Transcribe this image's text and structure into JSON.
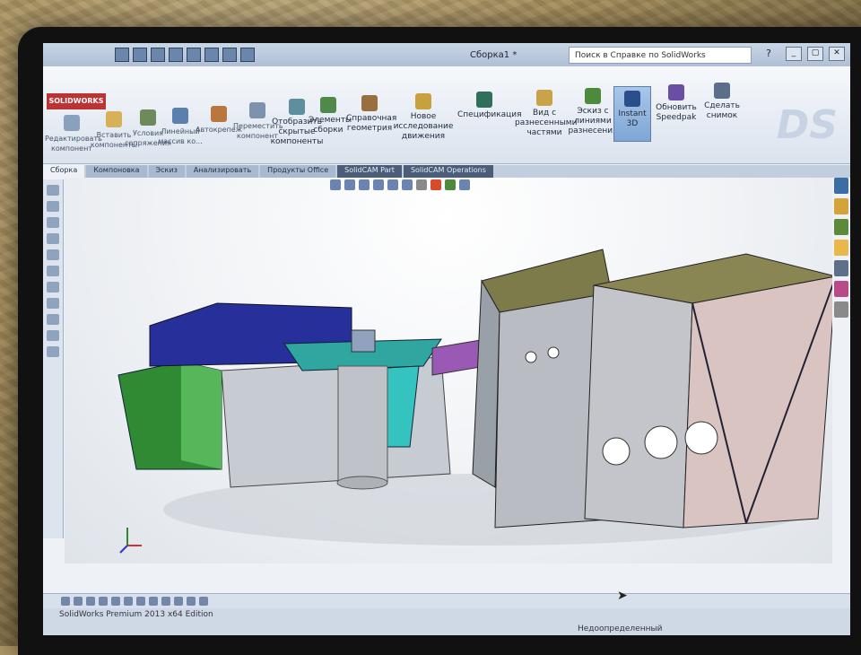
{
  "app": {
    "logo_text": "SOLIDWORKS",
    "document_title": "Сборка1 *",
    "help_search_placeholder": "Поиск в Справке по SolidWorks"
  },
  "ribbon": {
    "small_buttons": [
      {
        "label": "Редактировать компонент"
      },
      {
        "label": "Вставить компоненты"
      },
      {
        "label": "Условия сопряжения"
      },
      {
        "label": "Линейный массив ко..."
      },
      {
        "label": "Автокрепеж"
      },
      {
        "label": "Переместить компонент"
      },
      {
        "label": "Отобразить скрытые компоненты"
      },
      {
        "label": "Элементы сборки"
      },
      {
        "label": "Справочная геометрия"
      },
      {
        "label": "Новое исследование движения"
      },
      {
        "label": "Спецификация"
      },
      {
        "label": "Вид с разнесенными частями"
      },
      {
        "label": "Эскиз с линиями разнесения"
      },
      {
        "label": "Instant 3D"
      },
      {
        "label": "Обновить Speedpak"
      },
      {
        "label": "Сделать снимок"
      }
    ]
  },
  "tabs": [
    {
      "label": "Сборка",
      "active": true
    },
    {
      "label": "Компоновка"
    },
    {
      "label": "Эскиз"
    },
    {
      "label": "Анализировать"
    },
    {
      "label": "Продукты Office"
    },
    {
      "label": "SolidCAM Part"
    },
    {
      "label": "SolidCAM Operations"
    }
  ],
  "status": {
    "version_text": "SolidWorks Premium 2013 x64 Edition",
    "state_text": "Недоопределенный"
  },
  "colors": {
    "navy": "#27309a",
    "green": "#2f8a33",
    "teal": "#35b9b6",
    "olive": "#7e7b4b",
    "gray": "#b7b8bd",
    "purple": "#9b59b6",
    "pink": "#c9a9a6"
  }
}
